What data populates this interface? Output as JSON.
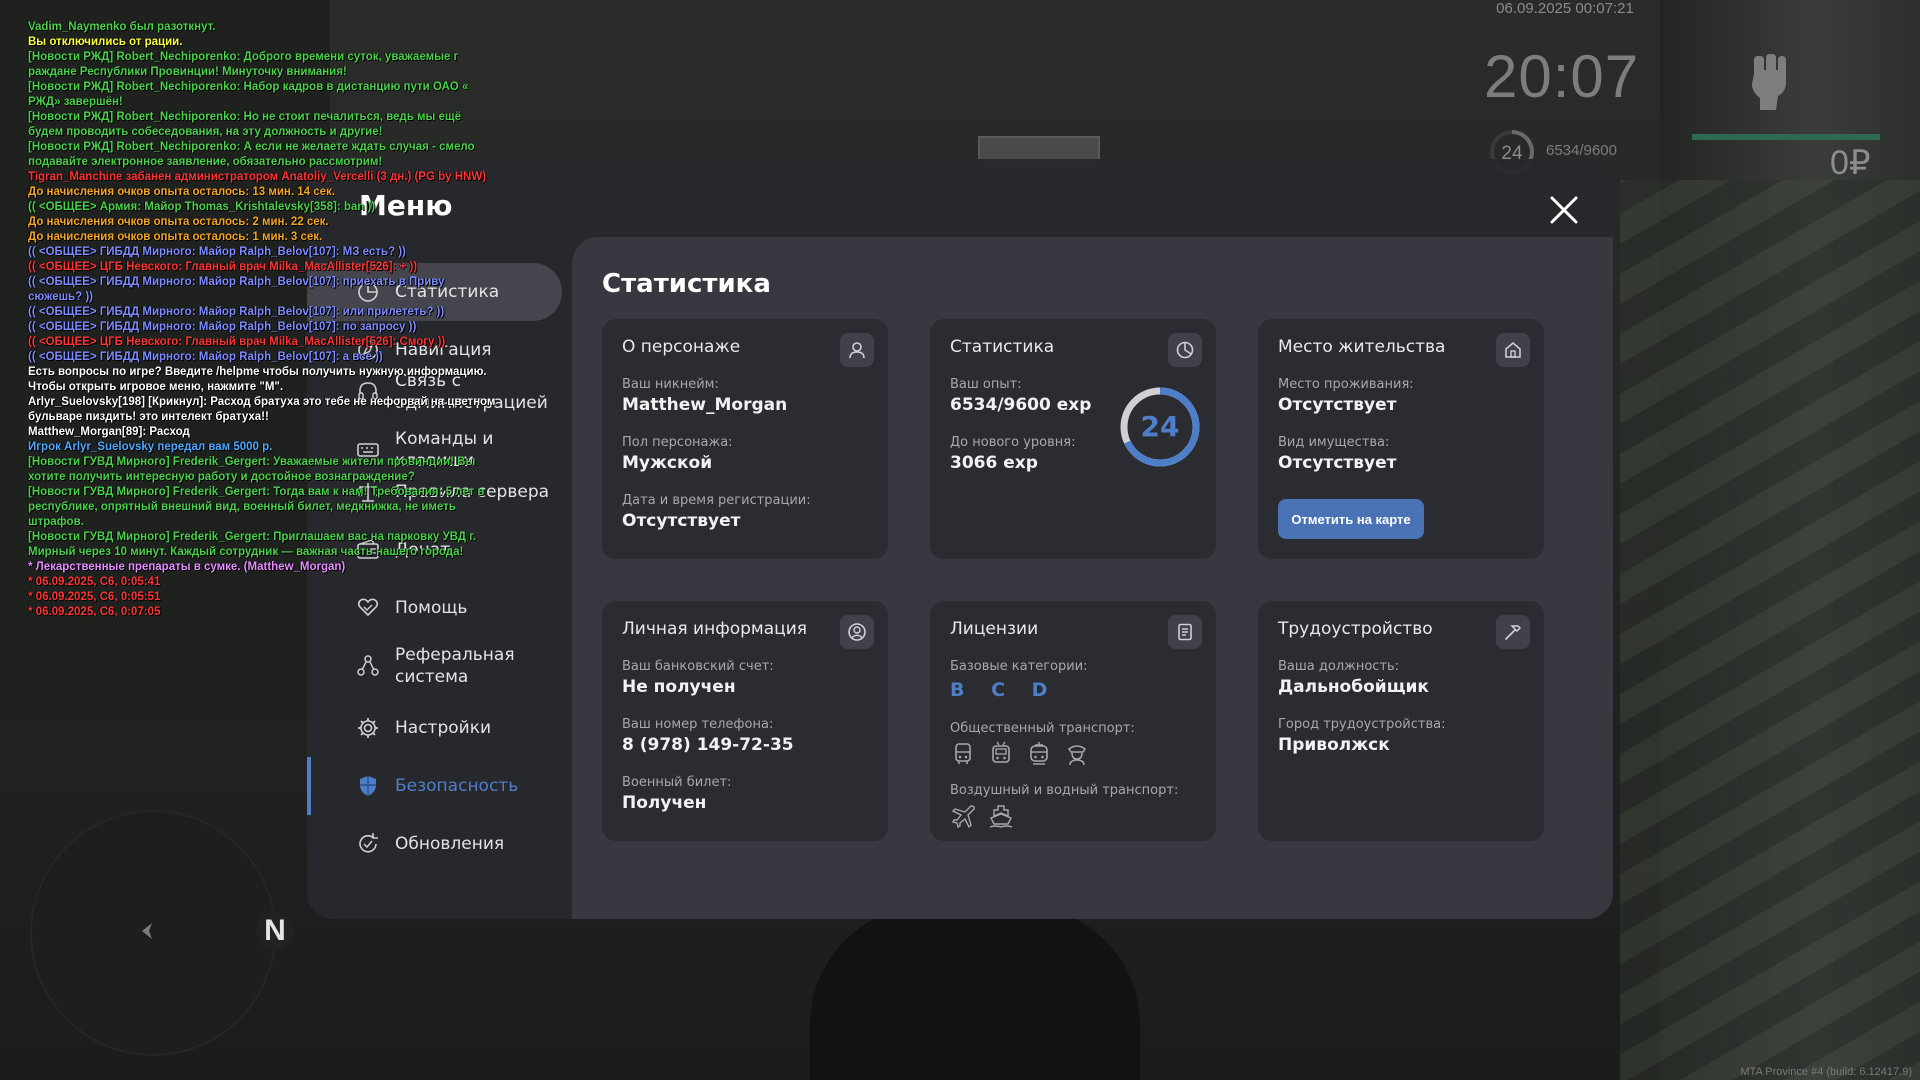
{
  "chat": [
    {
      "text": "Vadim_Naymenko был разоткнут.",
      "color": "#4cd14c"
    },
    {
      "text": "Вы отключились от рации.",
      "color": "#ffff3b"
    },
    {
      "text": "[Новости РЖД] Robert_Nechiporenko: Доброго времени суток, уважаемые г раждане Республики Провинции! Минуточку внимания!",
      "color": "#4cd14c"
    },
    {
      "text": "[Новости РЖД] Robert_Nechiporenko: Набор кадров в дистанцию пути ОАО « РЖД» завершён!",
      "color": "#4cd14c"
    },
    {
      "text": "[Новости РЖД] Robert_Nechiporenko: Но не стоит печалиться, ведь мы ещё будем проводить собеседования, на эту должность и другие!",
      "color": "#4cd14c"
    },
    {
      "text": "[Новости РЖД] Robert_Nechiporenko: А если не желаете ждать случая - смело подавайте электронное заявление, обязательно рассмотрим!",
      "color": "#4cd14c"
    },
    {
      "text": "Tigran_Manchine забанен администратором Anatoliy_Vercelli (3 дн.) (PG by HNW)",
      "color": "#ff3535"
    },
    {
      "text": "До начисления очков опыта осталось: 13 мин. 14 сек.",
      "color": "#f5a623"
    },
    {
      "text": "(( <ОБЩЕЕ> Армия: Майор Thomas_Krishtalevsky[358]: ban ))",
      "color": "#4cd14c"
    },
    {
      "text": "До начисления очков опыта осталось: 2 мин. 22 сек.",
      "color": "#f5a623"
    },
    {
      "text": "До начисления очков опыта осталось: 1 мин. 3 сек.",
      "color": "#f5a623"
    },
    {
      "text": "(( <ОБЩЕЕ> ГИБДД Мирного: Майор Ralph_Belov[107]: МЗ есть? ))",
      "color": "#7d8cff"
    },
    {
      "text": "(( <ОБЩЕЕ> ЦГБ Невского: Главный врач Milka_MacAllister[526]: + ))",
      "color": "#ff3535"
    },
    {
      "text": "(( <ОБЩЕЕ> ГИБДД Мирного: Майор Ralph_Belov[107]: приехать в Приву сюжешь? ))",
      "color": "#7d8cff"
    },
    {
      "text": "(( <ОБЩЕЕ> ГИБДД Мирного: Майор Ralph_Belov[107]: или прилететь? ))",
      "color": "#7d8cff"
    },
    {
      "text": "(( <ОБЩЕЕ> ГИБДД Мирного: Майор Ralph_Belov[107]: по запросу ))",
      "color": "#7d8cff"
    },
    {
      "text": "(( <ОБЩЕЕ> ЦГБ Невского: Главный врач Milka_MacAllister[526]: Смогу ))",
      "color": "#ff3535"
    },
    {
      "text": "(( <ОБЩЕЕ> ГИБДД Мирного: Майор Ralph_Belov[107]: а все ))",
      "color": "#7d8cff"
    },
    {
      "text": "Есть вопросы по игре? Введите /helpme чтобы получить нужную информацию.",
      "color": "#ffffff"
    },
    {
      "text": "Чтобы открыть игровое меню, нажмите \"M\".",
      "color": "#ffffff"
    },
    {
      "text": "Arlyr_Suelovsky[198] [Крикнул]: Расход братуха это тебе не нефорвай на цветном бульваре пиздить! это интелект братуха!!",
      "color": "#ffffff"
    },
    {
      "text": "Matthew_Morgan[89]: Расход",
      "color": "#ffffff"
    },
    {
      "text": "Игрок Arlyr_Suelovsky передал вам 5000 р.",
      "color": "#4fa9ff"
    },
    {
      "text": "[Новости ГУВД Мирного] Frederik_Gergert: Уважаемые жители провинции! Вы хотите получить интересную работу и достойное вознаграждение?",
      "color": "#4cd14c"
    },
    {
      "text": "[Новости ГУВД Мирного] Frederik_Gergert: Тогда вам к нам! Требования: 5 лет в республике, опрятный внешний вид, военный билет, медкнижка, не иметь штрафов.",
      "color": "#4cd14c"
    },
    {
      "text": "[Новости ГУВД Мирного] Frederik_Gergert: Приглашаем вас на парковку УВД г. Мирный через 10 минут. Каждый сотрудник — важная часть нашего города!",
      "color": "#4cd14c"
    },
    {
      "text": "* Лекарственные препараты в сумке. (Matthew_Morgan)",
      "color": "#e58cff"
    },
    {
      "text": "* 06.09.2025, С6, 0:05:41",
      "color": "#ff3535"
    },
    {
      "text": "* 06.09.2025, С6, 0:05:51",
      "color": "#ff3535"
    },
    {
      "text": "* 06.09.2025, С6, 0:07:05",
      "color": "#ff3535"
    }
  ],
  "hud": {
    "datetime": "06.09.2025 00:07:21",
    "clock": "20:07",
    "level": "24",
    "exp": "6534/9600",
    "money": "0₽",
    "build": "MTA Province #4 (build: 6.12417.9)"
  },
  "minimap": {
    "north": "N"
  },
  "menu": {
    "title": "Меню",
    "nav": [
      {
        "label": "Статистика",
        "icon": "pie-chart-icon"
      },
      {
        "label": "Навигация",
        "icon": "compass-icon"
      },
      {
        "label": "Связь с администрацией",
        "icon": "headset-icon"
      },
      {
        "label": "Команды и клавиши",
        "icon": "keyboard-icon"
      },
      {
        "label": "Правила сервера",
        "icon": "scales-icon"
      },
      {
        "label": "Донат",
        "icon": "wallet-icon"
      },
      {
        "label": "Помощь",
        "icon": "handshake-heart-icon"
      },
      {
        "label": "Реферальная система",
        "icon": "referral-icon"
      },
      {
        "label": "Настройки",
        "icon": "gear-icon"
      },
      {
        "label": "Безопасность",
        "icon": "shield-icon"
      },
      {
        "label": "Обновления",
        "icon": "refresh-icon"
      }
    ],
    "active_bg_index": 0,
    "selected_index": 9
  },
  "stats": {
    "title": "Статистика",
    "character": {
      "title": "О персонаже",
      "nickname_label": "Ваш никнейм:",
      "nickname": "Matthew_Morgan",
      "gender_label": "Пол персонажа:",
      "gender": "Мужской",
      "reg_label": "Дата и время регистрации:",
      "reg": "Отсутствует"
    },
    "statistics": {
      "title": "Статистика",
      "exp_label": "Ваш опыт:",
      "exp": "6534/9600 exp",
      "next_label": "До нового уровня:",
      "next": "3066 exp",
      "level": "24",
      "progress": 0.68
    },
    "residence": {
      "title": "Место жительства",
      "place_label": "Место проживания:",
      "place": "Отсутствует",
      "property_label": "Вид имущества:",
      "property": "Отсутствует",
      "button": "Отметить на карте"
    },
    "personal": {
      "title": "Личная информация",
      "bank_label": "Ваш банковский счет:",
      "bank": "Не получен",
      "phone_label": "Ваш номер телефона:",
      "phone": "8 (978) 149-72-35",
      "military_label": "Военный билет:",
      "military": "Получен"
    },
    "licenses": {
      "title": "Лицензии",
      "base_label": "Базовые категории:",
      "base": "B C D",
      "public_label": "Общественный транспорт:",
      "air_label": "Воздушный и водный транспорт:"
    },
    "employment": {
      "title": "Трудоустройство",
      "position_label": "Ваша должность:",
      "position": "Дальнобойщик",
      "city_label": "Город трудоустройства:",
      "city": "Приволжск"
    }
  },
  "colors": {
    "accent": "#4f7ec9",
    "button": "#4a73b5"
  }
}
